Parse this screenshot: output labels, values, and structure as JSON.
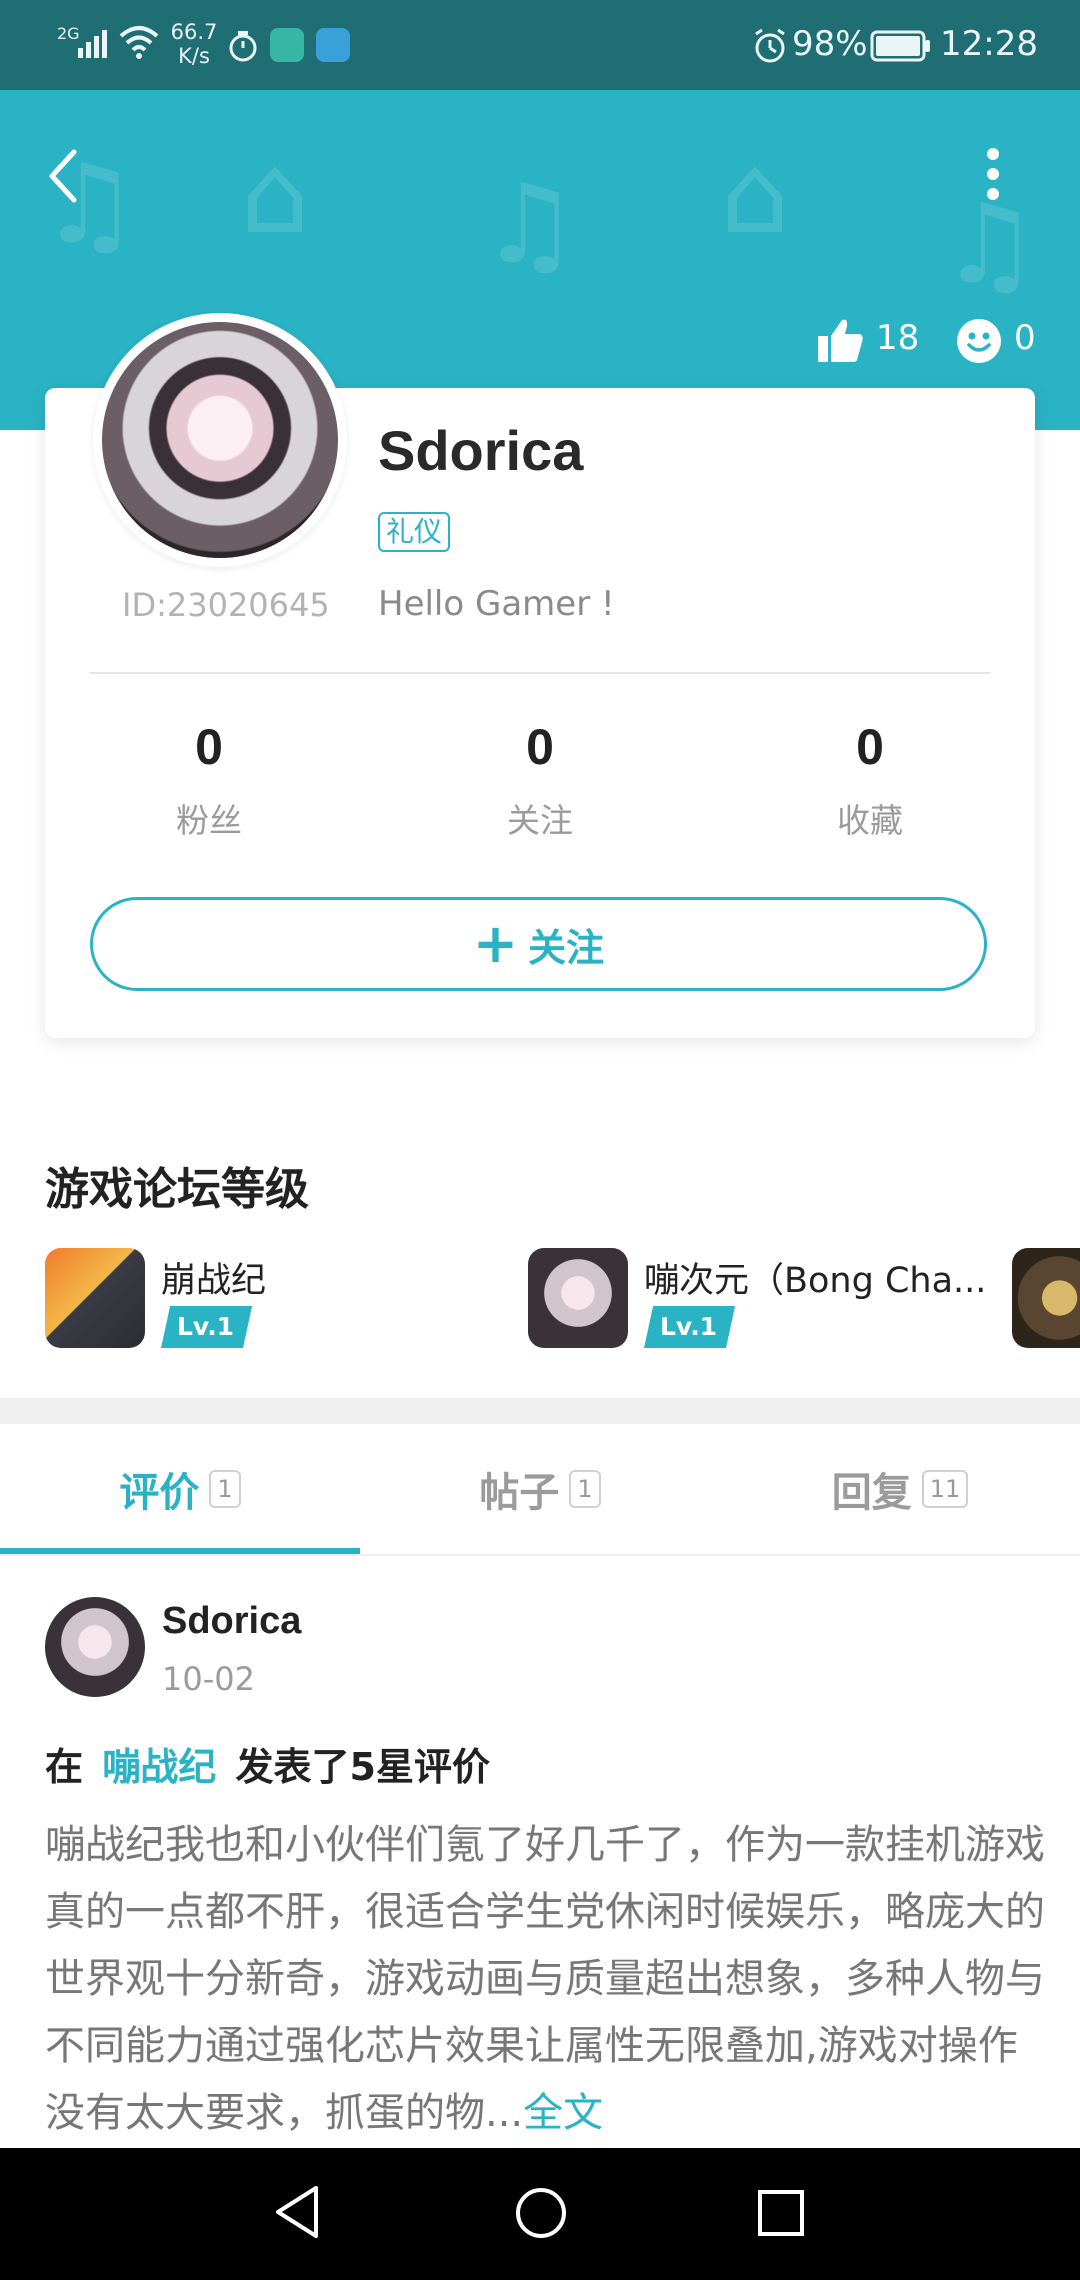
{
  "status_bar": {
    "network": "2G",
    "speed_value": "66.7",
    "speed_unit": "K/s",
    "battery": "98%",
    "time": "12:28"
  },
  "profile": {
    "likes": "18",
    "emoji_count": "0",
    "name": "Sdorica",
    "tag": "礼仪",
    "user_id": "ID:23020645",
    "bio": "Hello Gamer !",
    "stats": [
      {
        "value": "0",
        "label": "粉丝"
      },
      {
        "value": "0",
        "label": "关注"
      },
      {
        "value": "0",
        "label": "收藏"
      }
    ],
    "follow_label": "关注"
  },
  "forum_levels": {
    "title": "游戏论坛等级",
    "games": [
      {
        "name": "崩战纪",
        "level": "Lv.1"
      },
      {
        "name": "嘣次元（Bong Cha...",
        "level": "Lv.1"
      }
    ]
  },
  "tabs": [
    {
      "label": "评价",
      "count": "1",
      "active": true
    },
    {
      "label": "帖子",
      "count": "1",
      "active": false
    },
    {
      "label": "回复",
      "count": "11",
      "active": false
    }
  ],
  "post": {
    "author": "Sdorica",
    "date": "10-02",
    "headline_prefix": "在",
    "headline_game": "嘣战纪",
    "headline_suffix": "发表了5星评价",
    "body": "嘣战纪我也和小伙伴们氪了好几千了，作为一款挂机游戏真的一点都不肝，很适合学生党休闲时候娱乐，略庞大的世界观十分新奇，游戏动画与质量超出想象，多种人物与不同能力通过强化芯片效果让属性无限叠加,游戏对操作没有太大要求，抓蛋的物...",
    "more_label": "全文"
  },
  "colors": {
    "accent": "#2ab3c4",
    "status_bar": "#1f6e73",
    "nav_bar": "#000000"
  }
}
